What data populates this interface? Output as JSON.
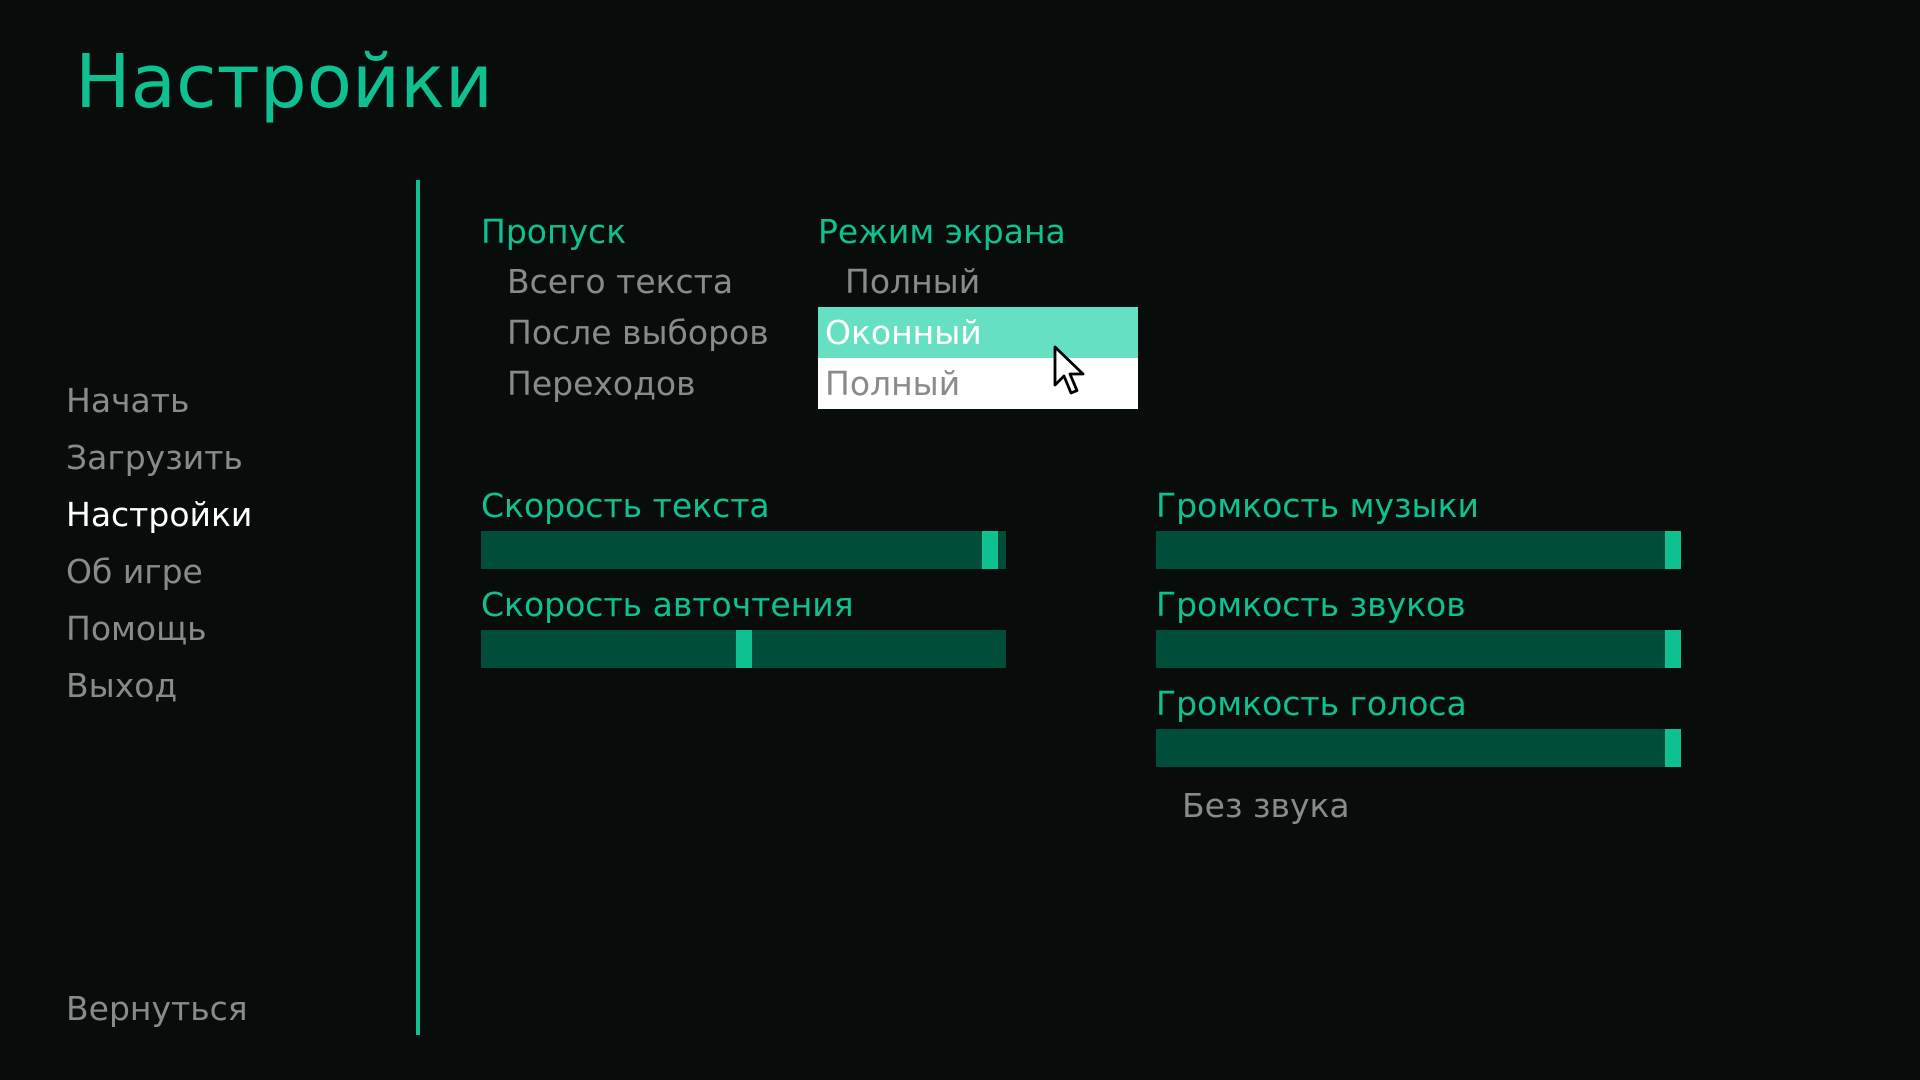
{
  "title": "Настройки",
  "nav": {
    "items": [
      {
        "label": "Начать"
      },
      {
        "label": "Загрузить"
      },
      {
        "label": "Настройки",
        "active": true
      },
      {
        "label": "Об игре"
      },
      {
        "label": "Помощь"
      },
      {
        "label": "Выход"
      }
    ],
    "return_label": "Вернуться"
  },
  "skip": {
    "label": "Пропуск",
    "options": [
      "Всего текста",
      "После выборов",
      "Переходов"
    ]
  },
  "display": {
    "label": "Режим экрана",
    "current": "Полный",
    "dropdown": [
      "Оконный",
      "Полный"
    ],
    "highlighted": "Оконный"
  },
  "sliders": {
    "text_speed": {
      "label": "Скорость текста",
      "value": 0.985
    },
    "auto_speed": {
      "label": "Скорость авточтения",
      "value": 0.5
    },
    "music_volume": {
      "label": "Громкость музыки",
      "value": 1.0
    },
    "sound_volume": {
      "label": "Громкость звуков",
      "value": 1.0
    },
    "voice_volume": {
      "label": "Громкость голоса",
      "value": 1.0
    }
  },
  "mute_label": "Без звука",
  "colors": {
    "accent": "#0fc190",
    "background": "#080d0c",
    "inactive_text": "#8a8a8a",
    "slider_track": "#004d3a",
    "highlight": "#66e0c3"
  }
}
